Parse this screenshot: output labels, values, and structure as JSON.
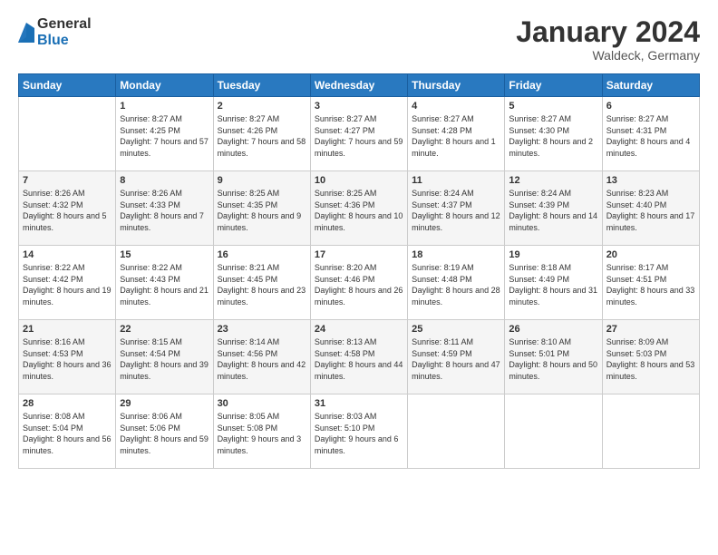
{
  "logo": {
    "general": "General",
    "blue": "Blue"
  },
  "title": {
    "month_year": "January 2024",
    "location": "Waldeck, Germany"
  },
  "days_header": [
    "Sunday",
    "Monday",
    "Tuesday",
    "Wednesday",
    "Thursday",
    "Friday",
    "Saturday"
  ],
  "weeks": [
    [
      {
        "day": "",
        "sunrise": "",
        "sunset": "",
        "daylight": ""
      },
      {
        "day": "1",
        "sunrise": "Sunrise: 8:27 AM",
        "sunset": "Sunset: 4:25 PM",
        "daylight": "Daylight: 7 hours and 57 minutes."
      },
      {
        "day": "2",
        "sunrise": "Sunrise: 8:27 AM",
        "sunset": "Sunset: 4:26 PM",
        "daylight": "Daylight: 7 hours and 58 minutes."
      },
      {
        "day": "3",
        "sunrise": "Sunrise: 8:27 AM",
        "sunset": "Sunset: 4:27 PM",
        "daylight": "Daylight: 7 hours and 59 minutes."
      },
      {
        "day": "4",
        "sunrise": "Sunrise: 8:27 AM",
        "sunset": "Sunset: 4:28 PM",
        "daylight": "Daylight: 8 hours and 1 minute."
      },
      {
        "day": "5",
        "sunrise": "Sunrise: 8:27 AM",
        "sunset": "Sunset: 4:30 PM",
        "daylight": "Daylight: 8 hours and 2 minutes."
      },
      {
        "day": "6",
        "sunrise": "Sunrise: 8:27 AM",
        "sunset": "Sunset: 4:31 PM",
        "daylight": "Daylight: 8 hours and 4 minutes."
      }
    ],
    [
      {
        "day": "7",
        "sunrise": "Sunrise: 8:26 AM",
        "sunset": "Sunset: 4:32 PM",
        "daylight": "Daylight: 8 hours and 5 minutes."
      },
      {
        "day": "8",
        "sunrise": "Sunrise: 8:26 AM",
        "sunset": "Sunset: 4:33 PM",
        "daylight": "Daylight: 8 hours and 7 minutes."
      },
      {
        "day": "9",
        "sunrise": "Sunrise: 8:25 AM",
        "sunset": "Sunset: 4:35 PM",
        "daylight": "Daylight: 8 hours and 9 minutes."
      },
      {
        "day": "10",
        "sunrise": "Sunrise: 8:25 AM",
        "sunset": "Sunset: 4:36 PM",
        "daylight": "Daylight: 8 hours and 10 minutes."
      },
      {
        "day": "11",
        "sunrise": "Sunrise: 8:24 AM",
        "sunset": "Sunset: 4:37 PM",
        "daylight": "Daylight: 8 hours and 12 minutes."
      },
      {
        "day": "12",
        "sunrise": "Sunrise: 8:24 AM",
        "sunset": "Sunset: 4:39 PM",
        "daylight": "Daylight: 8 hours and 14 minutes."
      },
      {
        "day": "13",
        "sunrise": "Sunrise: 8:23 AM",
        "sunset": "Sunset: 4:40 PM",
        "daylight": "Daylight: 8 hours and 17 minutes."
      }
    ],
    [
      {
        "day": "14",
        "sunrise": "Sunrise: 8:22 AM",
        "sunset": "Sunset: 4:42 PM",
        "daylight": "Daylight: 8 hours and 19 minutes."
      },
      {
        "day": "15",
        "sunrise": "Sunrise: 8:22 AM",
        "sunset": "Sunset: 4:43 PM",
        "daylight": "Daylight: 8 hours and 21 minutes."
      },
      {
        "day": "16",
        "sunrise": "Sunrise: 8:21 AM",
        "sunset": "Sunset: 4:45 PM",
        "daylight": "Daylight: 8 hours and 23 minutes."
      },
      {
        "day": "17",
        "sunrise": "Sunrise: 8:20 AM",
        "sunset": "Sunset: 4:46 PM",
        "daylight": "Daylight: 8 hours and 26 minutes."
      },
      {
        "day": "18",
        "sunrise": "Sunrise: 8:19 AM",
        "sunset": "Sunset: 4:48 PM",
        "daylight": "Daylight: 8 hours and 28 minutes."
      },
      {
        "day": "19",
        "sunrise": "Sunrise: 8:18 AM",
        "sunset": "Sunset: 4:49 PM",
        "daylight": "Daylight: 8 hours and 31 minutes."
      },
      {
        "day": "20",
        "sunrise": "Sunrise: 8:17 AM",
        "sunset": "Sunset: 4:51 PM",
        "daylight": "Daylight: 8 hours and 33 minutes."
      }
    ],
    [
      {
        "day": "21",
        "sunrise": "Sunrise: 8:16 AM",
        "sunset": "Sunset: 4:53 PM",
        "daylight": "Daylight: 8 hours and 36 minutes."
      },
      {
        "day": "22",
        "sunrise": "Sunrise: 8:15 AM",
        "sunset": "Sunset: 4:54 PM",
        "daylight": "Daylight: 8 hours and 39 minutes."
      },
      {
        "day": "23",
        "sunrise": "Sunrise: 8:14 AM",
        "sunset": "Sunset: 4:56 PM",
        "daylight": "Daylight: 8 hours and 42 minutes."
      },
      {
        "day": "24",
        "sunrise": "Sunrise: 8:13 AM",
        "sunset": "Sunset: 4:58 PM",
        "daylight": "Daylight: 8 hours and 44 minutes."
      },
      {
        "day": "25",
        "sunrise": "Sunrise: 8:11 AM",
        "sunset": "Sunset: 4:59 PM",
        "daylight": "Daylight: 8 hours and 47 minutes."
      },
      {
        "day": "26",
        "sunrise": "Sunrise: 8:10 AM",
        "sunset": "Sunset: 5:01 PM",
        "daylight": "Daylight: 8 hours and 50 minutes."
      },
      {
        "day": "27",
        "sunrise": "Sunrise: 8:09 AM",
        "sunset": "Sunset: 5:03 PM",
        "daylight": "Daylight: 8 hours and 53 minutes."
      }
    ],
    [
      {
        "day": "28",
        "sunrise": "Sunrise: 8:08 AM",
        "sunset": "Sunset: 5:04 PM",
        "daylight": "Daylight: 8 hours and 56 minutes."
      },
      {
        "day": "29",
        "sunrise": "Sunrise: 8:06 AM",
        "sunset": "Sunset: 5:06 PM",
        "daylight": "Daylight: 8 hours and 59 minutes."
      },
      {
        "day": "30",
        "sunrise": "Sunrise: 8:05 AM",
        "sunset": "Sunset: 5:08 PM",
        "daylight": "Daylight: 9 hours and 3 minutes."
      },
      {
        "day": "31",
        "sunrise": "Sunrise: 8:03 AM",
        "sunset": "Sunset: 5:10 PM",
        "daylight": "Daylight: 9 hours and 6 minutes."
      },
      {
        "day": "",
        "sunrise": "",
        "sunset": "",
        "daylight": ""
      },
      {
        "day": "",
        "sunrise": "",
        "sunset": "",
        "daylight": ""
      },
      {
        "day": "",
        "sunrise": "",
        "sunset": "",
        "daylight": ""
      }
    ]
  ]
}
